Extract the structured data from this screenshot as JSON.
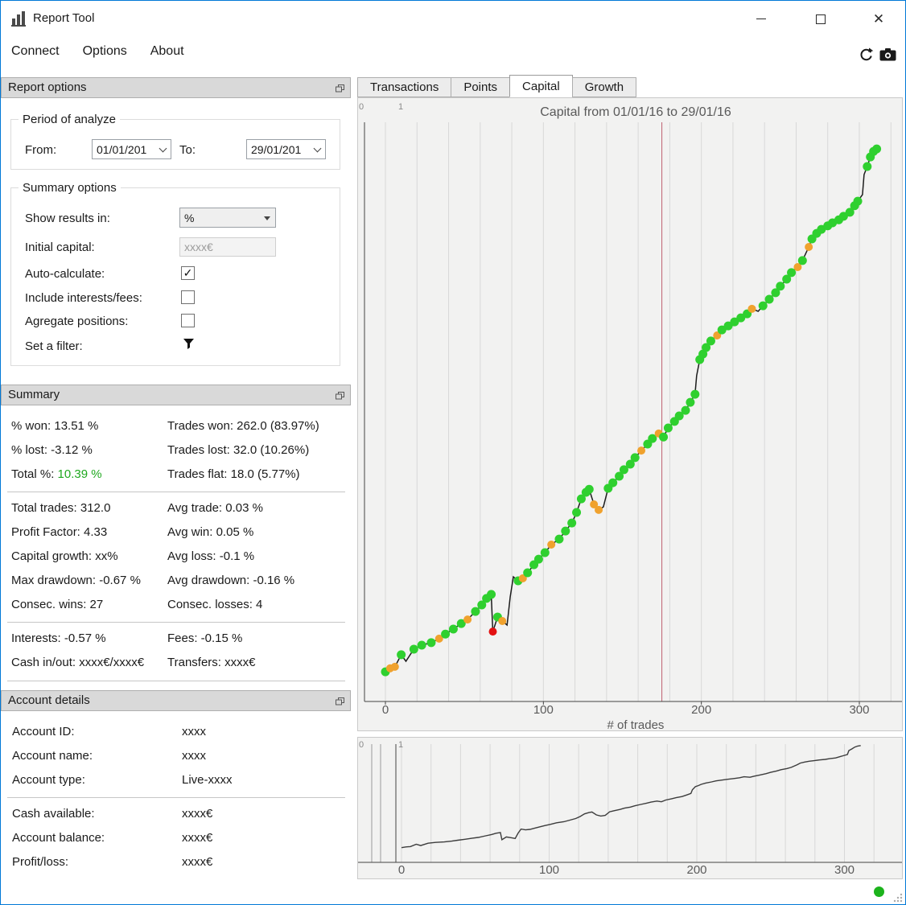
{
  "window": {
    "title": "Report Tool"
  },
  "menubar": {
    "items": [
      "Connect",
      "Options",
      "About"
    ]
  },
  "report_options": {
    "title": "Report options",
    "period_group": "Period of analyze",
    "from_label": "From:",
    "from_value": "01/01/201",
    "to_label": "To:",
    "to_value": "29/01/201",
    "summary_group": "Summary options",
    "show_results_label": "Show results in:",
    "show_results_value": "%",
    "initial_capital_label": "Initial capital:",
    "initial_capital_value": "xxxx€",
    "auto_calculate_label": "Auto-calculate:",
    "auto_calculate_checked": "✓",
    "include_interests_label": "Include interests/fees:",
    "agregate_label": "Agregate positions:",
    "filter_label": "Set a filter:"
  },
  "summary": {
    "title": "Summary",
    "block1": [
      {
        "left": "% won: 13.51 %",
        "right": "Trades won: 262.0 (83.97%)"
      },
      {
        "left": "% lost: -3.12 %",
        "right": "Trades lost: 32.0 (10.26%)"
      },
      {
        "left_label": "Total %: ",
        "left_value": "10.39 %",
        "right": "Trades flat: 18.0 (5.77%)"
      }
    ],
    "block2": [
      {
        "left": "Total trades: 312.0",
        "right": "Avg trade: 0.03 %"
      },
      {
        "left": "Profit Factor: 4.33",
        "right": "Avg win: 0.05 %"
      },
      {
        "left": "Capital growth: xx%",
        "right": "Avg loss: -0.1 %"
      },
      {
        "left": "Max drawdown: -0.67 %",
        "right": "Avg drawdown: -0.16 %"
      },
      {
        "left": "Consec. wins: 27",
        "right": "Consec. losses: 4"
      }
    ],
    "block3": [
      {
        "left": "Interests: -0.57 %",
        "right": "Fees: -0.15 %"
      },
      {
        "left": "Cash in/out: xxxx€/xxxx€",
        "right": "Transfers: xxxx€"
      }
    ]
  },
  "account_details": {
    "title": "Account details",
    "block1": [
      {
        "left": "Account ID:",
        "right": "xxxx"
      },
      {
        "left": "Account name:",
        "right": "xxxx"
      },
      {
        "left": "Account type:",
        "right": "Live-xxxx"
      }
    ],
    "block2": [
      {
        "left": "Cash available:",
        "right": "xxxx€"
      },
      {
        "left": "Account balance:",
        "right": "xxxx€"
      },
      {
        "left": "Profit/loss:",
        "right": "xxxx€"
      }
    ]
  },
  "tabs": {
    "items": [
      "Transactions",
      "Points",
      "Capital",
      "Growth"
    ],
    "active": "Capital"
  },
  "chart_data": {
    "type": "line",
    "title": "Capital from 01/01/16 to 29/01/16",
    "xlabel": "# of trades",
    "xticks": [
      0,
      100,
      200,
      300
    ],
    "xlim": [
      -17,
      328
    ],
    "ylim": [
      -1.1,
      11.5
    ],
    "grid": {
      "start": 0,
      "end": 320,
      "step": 20
    },
    "vline_x": 175,
    "range_labels": [
      "0",
      "1"
    ],
    "legend": {
      "win_marker": "green",
      "flat_marker": "orange",
      "loss_marker": "red"
    },
    "colors": {
      "line": "#1c1c1c",
      "mini_line": "#3c3c3c",
      "win": "#2fd02f",
      "flat": "#f0a22e",
      "loss": "#e31212",
      "grid": "#d8d8d8",
      "vline": "#bf5f6f",
      "bg": "#f2f2f1"
    },
    "series": [
      {
        "name": "capital",
        "points": [
          [
            0,
            0.11,
            "g"
          ],
          [
            3,
            0.18,
            "o"
          ],
          [
            6,
            0.21,
            "o"
          ],
          [
            10,
            0.45,
            "g"
          ],
          [
            13,
            0.32,
            "n"
          ],
          [
            18,
            0.56,
            "g"
          ],
          [
            23,
            0.64,
            "g"
          ],
          [
            29,
            0.69,
            "g"
          ],
          [
            34,
            0.77,
            "o"
          ],
          [
            38,
            0.86,
            "g"
          ],
          [
            43,
            0.96,
            "g"
          ],
          [
            48,
            1.07,
            "g"
          ],
          [
            52,
            1.15,
            "o"
          ],
          [
            57,
            1.31,
            "g"
          ],
          [
            61,
            1.44,
            "g"
          ],
          [
            64,
            1.57,
            "g"
          ],
          [
            67,
            1.65,
            "g"
          ],
          [
            68,
            0.91,
            "r"
          ],
          [
            71,
            1.2,
            "g"
          ],
          [
            74,
            1.12,
            "o"
          ],
          [
            77,
            1.04,
            "n"
          ],
          [
            79,
            1.6,
            "n"
          ],
          [
            81,
            2.0,
            "n"
          ],
          [
            84,
            1.92,
            "g"
          ],
          [
            87,
            1.97,
            "o"
          ],
          [
            90,
            2.08,
            "g"
          ],
          [
            94,
            2.24,
            "g"
          ],
          [
            97,
            2.35,
            "g"
          ],
          [
            101,
            2.48,
            "g"
          ],
          [
            105,
            2.64,
            "o"
          ],
          [
            110,
            2.75,
            "g"
          ],
          [
            114,
            2.91,
            "g"
          ],
          [
            118,
            3.07,
            "g"
          ],
          [
            121,
            3.28,
            "g"
          ],
          [
            124,
            3.55,
            "g"
          ],
          [
            127,
            3.68,
            "g"
          ],
          [
            129,
            3.74,
            "g"
          ],
          [
            132,
            3.44,
            "o"
          ],
          [
            135,
            3.33,
            "o"
          ],
          [
            138,
            3.39,
            "n"
          ],
          [
            141,
            3.76,
            "g"
          ],
          [
            144,
            3.87,
            "g"
          ],
          [
            148,
            4.0,
            "g"
          ],
          [
            151,
            4.13,
            "g"
          ],
          [
            155,
            4.24,
            "g"
          ],
          [
            158,
            4.37,
            "g"
          ],
          [
            162,
            4.51,
            "o"
          ],
          [
            166,
            4.64,
            "g"
          ],
          [
            169,
            4.75,
            "g"
          ],
          [
            173,
            4.85,
            "o"
          ],
          [
            176,
            4.78,
            "g"
          ],
          [
            179,
            4.96,
            "g"
          ],
          [
            183,
            5.09,
            "g"
          ],
          [
            186,
            5.2,
            "g"
          ],
          [
            190,
            5.31,
            "g"
          ],
          [
            193,
            5.47,
            "g"
          ],
          [
            196,
            5.63,
            "g"
          ],
          [
            197,
            6.0,
            "n"
          ],
          [
            199,
            6.32,
            "g"
          ],
          [
            201,
            6.43,
            "g"
          ],
          [
            203,
            6.56,
            "g"
          ],
          [
            206,
            6.69,
            "g"
          ],
          [
            210,
            6.8,
            "o"
          ],
          [
            213,
            6.91,
            "g"
          ],
          [
            217,
            6.99,
            "g"
          ],
          [
            221,
            7.07,
            "g"
          ],
          [
            225,
            7.15,
            "g"
          ],
          [
            229,
            7.23,
            "g"
          ],
          [
            232,
            7.33,
            "o"
          ],
          [
            236,
            7.28,
            "n"
          ],
          [
            239,
            7.39,
            "g"
          ],
          [
            243,
            7.52,
            "g"
          ],
          [
            247,
            7.65,
            "g"
          ],
          [
            250,
            7.78,
            "g"
          ],
          [
            254,
            7.92,
            "g"
          ],
          [
            257,
            8.05,
            "g"
          ],
          [
            261,
            8.16,
            "o"
          ],
          [
            264,
            8.29,
            "g"
          ],
          [
            268,
            8.56,
            "o"
          ],
          [
            270,
            8.72,
            "g"
          ],
          [
            273,
            8.83,
            "g"
          ],
          [
            276,
            8.91,
            "g"
          ],
          [
            280,
            8.98,
            "g"
          ],
          [
            283,
            9.04,
            "g"
          ],
          [
            287,
            9.1,
            "g"
          ],
          [
            290,
            9.17,
            "g"
          ],
          [
            294,
            9.25,
            "g"
          ],
          [
            297,
            9.38,
            "g"
          ],
          [
            299,
            9.47,
            "g"
          ],
          [
            302,
            9.6,
            "n"
          ],
          [
            303,
            10.0,
            "n"
          ],
          [
            305,
            10.16,
            "g"
          ],
          [
            307,
            10.35,
            "g"
          ],
          [
            309,
            10.46,
            "g"
          ],
          [
            311,
            10.51,
            "g"
          ]
        ]
      }
    ]
  },
  "status": {
    "indicator_color": "#1cb31c"
  }
}
